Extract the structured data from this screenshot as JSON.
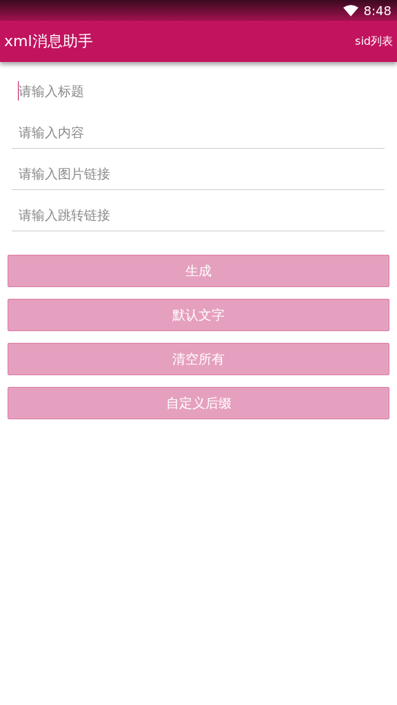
{
  "status_bar": {
    "time": "8:48"
  },
  "app_bar": {
    "title": "xml消息助手",
    "action": "sid列表"
  },
  "fields": [
    {
      "placeholder": "请输入标题",
      "focused": true
    },
    {
      "placeholder": "请输入内容",
      "focused": false
    },
    {
      "placeholder": "请输入图片链接",
      "focused": false
    },
    {
      "placeholder": "请输入跳转链接",
      "focused": false
    }
  ],
  "buttons": [
    "生成",
    "默认文字",
    "清空所有",
    "自定义后缀"
  ]
}
